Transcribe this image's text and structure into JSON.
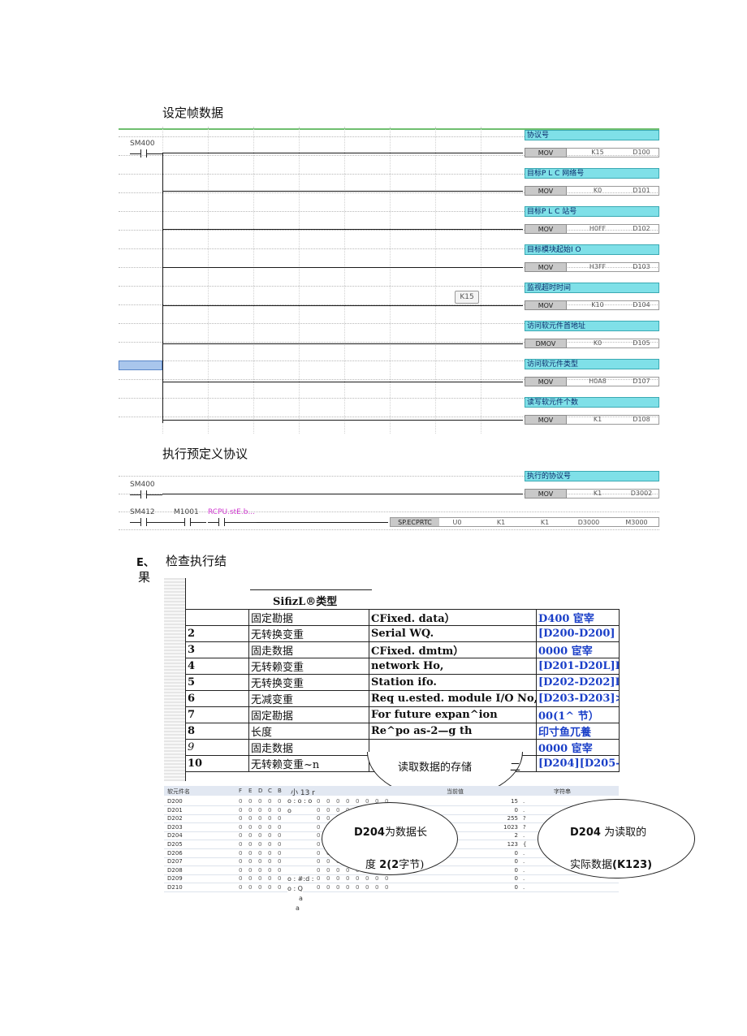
{
  "sections": {
    "set_frame": "设定帧数据",
    "exec_protocol": "执行预定义协议",
    "check_label": "E、",
    "check_title_1": "检查执行结",
    "check_title_2": "果"
  },
  "ladder1": {
    "contact": "SM400",
    "tooltip": "K15",
    "rows": [
      {
        "comment": "协议号",
        "op": "MOV",
        "a1": "K15",
        "a2": "D100"
      },
      {
        "comment": "目标P L C 网络号",
        "op": "MOV",
        "a1": "K0",
        "a2": "D101"
      },
      {
        "comment": "目标P L C 站号",
        "op": "MOV",
        "a1": "H0FF",
        "a2": "D102"
      },
      {
        "comment": "目标模块起始I O",
        "op": "MOV",
        "a1": "H3FF",
        "a2": "D103"
      },
      {
        "comment": "监视超时时间",
        "op": "MOV",
        "a1": "K10",
        "a2": "D104"
      },
      {
        "comment": "访问软元件首地址",
        "op": "DMOV",
        "a1": "K0",
        "a2": "D105"
      },
      {
        "comment": "访问软元件类型",
        "op": "MOV",
        "a1": "H0A8",
        "a2": "D107"
      },
      {
        "comment": "读写软元件个数",
        "op": "MOV",
        "a1": "K1",
        "a2": "D108"
      }
    ]
  },
  "ladder2": {
    "row1": {
      "contact": "SM400",
      "comment": "执行的协议号",
      "op": "MOV",
      "a1": "K1",
      "a2": "D3002"
    },
    "row2": {
      "contact1": "SM412",
      "contact2": "M1001",
      "contact3": "RCPU.stE.b...",
      "op": "SP.ECPRTC",
      "args": [
        "U0",
        "K1",
        "K1",
        "D3000",
        "M3000"
      ]
    }
  },
  "table": {
    "header": "SifizL®类型",
    "rows": [
      {
        "no": "",
        "kind": "固定勘据",
        "content": "CFixed. data）",
        "dev": "D400 宦宰"
      },
      {
        "no": "2",
        "kind": "无转换变重",
        "content": "Serial WQ.",
        "dev": "[D200-D200]"
      },
      {
        "no": "3",
        "kind": "固走数据",
        "content": "CFixed. dmtm）",
        "dev": "0000 宦宰"
      },
      {
        "no": "4",
        "kind": "无转赖变重",
        "content": "network Ho,",
        "dev": "[D201-D20L]I"
      },
      {
        "no": "5",
        "kind": "无转换变重",
        "content": "Station ifo.",
        "dev": "[D202-D202]I"
      },
      {
        "no": "6",
        "kind": "无减变重",
        "content": "Req u.ested. module I/O No,",
        "dev": "[D203-D203]>"
      },
      {
        "no": "7",
        "kind": "固定勘据",
        "content": "For future expan^ion",
        "dev": "00(1^ 节）"
      },
      {
        "no": "8",
        "kind": "长度",
        "content": "Re^po as-2—g th",
        "dev": "印寸鱼兀養"
      },
      {
        "no": "9",
        "kind": "固走数据",
        "content": "",
        "dev": "0000 宦宰"
      },
      {
        "no": "10",
        "kind": "无转赖变重~n",
        "content": "",
        "dev": "[D204][D205-"
      }
    ],
    "callout": "读取数据的存储",
    "callout_tail": "二"
  },
  "monitor": {
    "head_device": "软元件名",
    "bits": [
      "F",
      "E",
      "D",
      "C",
      "B"
    ],
    "overlay_text": "小 13 r",
    "col_value": "当前值",
    "col_str": "字符串",
    "rows": [
      {
        "dev": "D200",
        "val": "15",
        "str": "."
      },
      {
        "dev": "D201",
        "val": "0",
        "str": "."
      },
      {
        "dev": "D202",
        "val": "255",
        "str": "?"
      },
      {
        "dev": "D203",
        "val": "1023",
        "str": "?"
      },
      {
        "dev": "D204",
        "val": "2",
        "str": "."
      },
      {
        "dev": "D205",
        "val": "123",
        "str": "{"
      },
      {
        "dev": "D206",
        "val": "0",
        "str": "."
      },
      {
        "dev": "D207",
        "val": "0",
        "str": "."
      },
      {
        "dev": "D208",
        "val": "0",
        "str": "."
      },
      {
        "dev": "D209",
        "val": "0",
        "str": "."
      },
      {
        "dev": "D210",
        "val": "0",
        "str": "."
      }
    ],
    "noise": [
      "o : o : o",
      "o",
      "o : Q",
      "a",
      "a",
      "o : #:d :"
    ],
    "bubble1_a": "D204",
    "bubble1_b": "为数据长",
    "bubble1_c": "度",
    "bubble1_d": "2(2",
    "bubble1_e": "字节)",
    "bubble2_a": "D204",
    "bubble2_b": "为读取的",
    "bubble2_c": "实际数据",
    "bubble2_d": "(K123)"
  }
}
